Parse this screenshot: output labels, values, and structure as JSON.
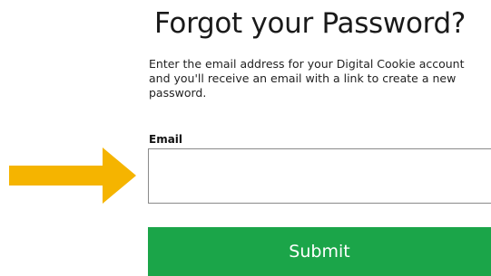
{
  "header": {
    "title": "Forgot your Password?"
  },
  "form": {
    "instructions": "Enter the email address for your Digital Cookie account and you'll receive an email with a link to create a new password.",
    "email_label": "Email",
    "email_value": "",
    "submit_label": "Submit"
  },
  "annotation": {
    "icon": "arrow-right-icon",
    "color": "#f5b400"
  },
  "colors": {
    "submit_background": "#1ba549",
    "submit_text": "#ffffff",
    "input_border": "#8a8a8a"
  }
}
